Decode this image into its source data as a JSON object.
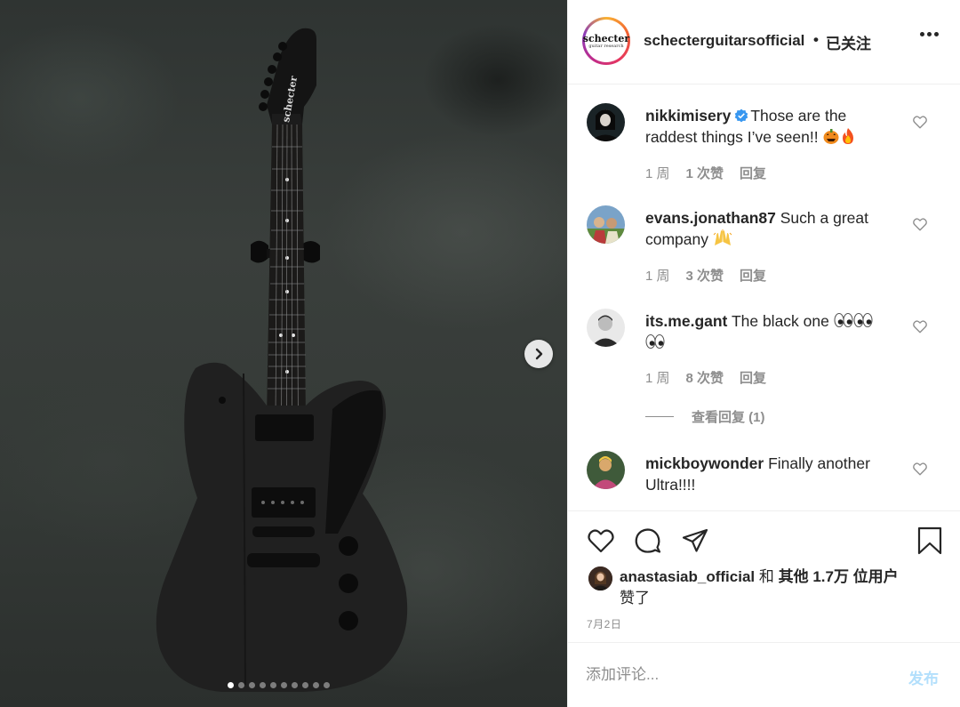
{
  "media": {
    "brand_on_headstock": "schecter",
    "carousel": {
      "total": 10,
      "active_index": 0
    },
    "next_icon": "chevron-right-icon"
  },
  "header": {
    "username": "schecterguitarsofficial",
    "separator": "•",
    "follow_status": "已关注",
    "avatar_logo": "schecter",
    "avatar_logo_sub": "guitar research",
    "more_icon": "more-horizontal-icon"
  },
  "comments": [
    {
      "username": "nikkimisery",
      "verified": true,
      "text": "Those are the raddest things I’ve seen!!",
      "emojis": [
        "jack-o-lantern",
        "fire"
      ],
      "time": "1 周",
      "likes": "1 次赞",
      "reply": "回复"
    },
    {
      "username": "evans.jonathan87",
      "verified": false,
      "text": "Such a great company",
      "emojis": [
        "raising-hands"
      ],
      "time": "1 周",
      "likes": "3 次赞",
      "reply": "回复"
    },
    {
      "username": "its.me.gant",
      "verified": false,
      "text": "The black one",
      "emojis": [
        "eyes",
        "eyes",
        "eyes"
      ],
      "time": "1 周",
      "likes": "8 次赞",
      "reply": "回复"
    },
    {
      "username": "mickboywonder",
      "verified": false,
      "text": "Finally another Ultra!!!!"
    }
  ],
  "view_replies": "查看回复 (1)",
  "actions": {
    "icons": [
      "heart-icon",
      "comment-icon",
      "share-icon",
      "bookmark-icon"
    ]
  },
  "likes": {
    "first_user": "anastasiab_official",
    "connector": "和",
    "others": "其他 1.7万 位用户",
    "suffix": "赞了"
  },
  "date": "7月2日",
  "comment_box": {
    "placeholder": "添加评论...",
    "post_label": "发布"
  },
  "colors": {
    "post_disabled": "#b2dffc",
    "verified_blue": "#3897f0",
    "muted_text": "#8e8e8e",
    "primary_text": "#262626"
  }
}
